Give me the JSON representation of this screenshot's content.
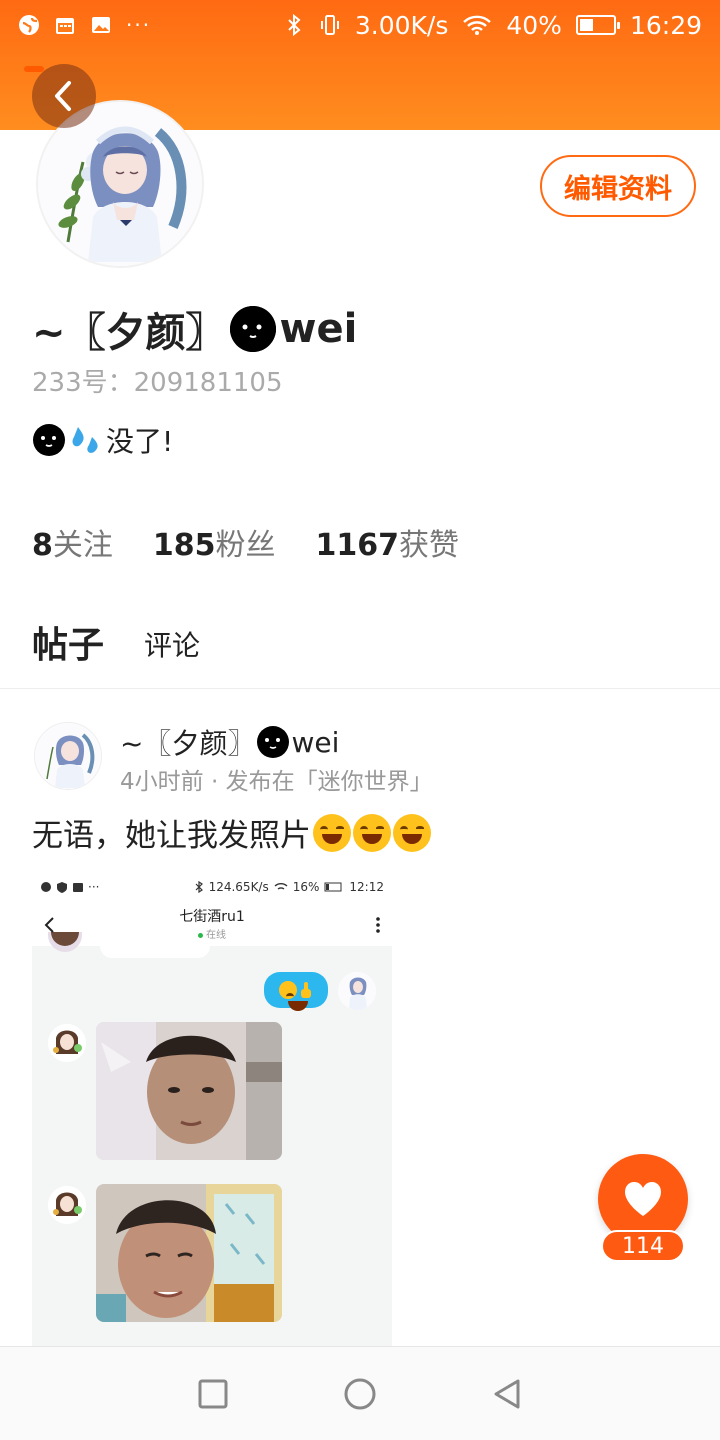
{
  "status_bar": {
    "speed": "3.00K/s",
    "battery": "40%",
    "battery_level": 0.4,
    "time": "16:29",
    "dots": "···"
  },
  "profile": {
    "name_prefix": "~〖夕颜〗",
    "name_suffix": "wei",
    "uid": "233号：209181105",
    "bio": "没了!",
    "edit_label": "编辑资料"
  },
  "stats": [
    {
      "num": "8",
      "label": "关注"
    },
    {
      "num": "185",
      "label": "粉丝"
    },
    {
      "num": "1167",
      "label": "获赞"
    }
  ],
  "tabs": {
    "posts": "帖子",
    "comments": "评论"
  },
  "post": {
    "author_prefix": "~〖夕颜〗",
    "author_suffix": "wei",
    "meta": "4小时前 · 发布在「迷你世界」",
    "text": "无语，她让我发照片",
    "likes": "114"
  },
  "embedded_shot": {
    "status_speed": "124.65K/s",
    "status_battery": "16%",
    "status_time": "12:12",
    "chat_title": "七街酒ru1",
    "chat_status": "在线"
  },
  "colors": {
    "accent": "#ff5a12",
    "header_top": "#ff6a12",
    "header_bottom": "#ff8d1f"
  }
}
